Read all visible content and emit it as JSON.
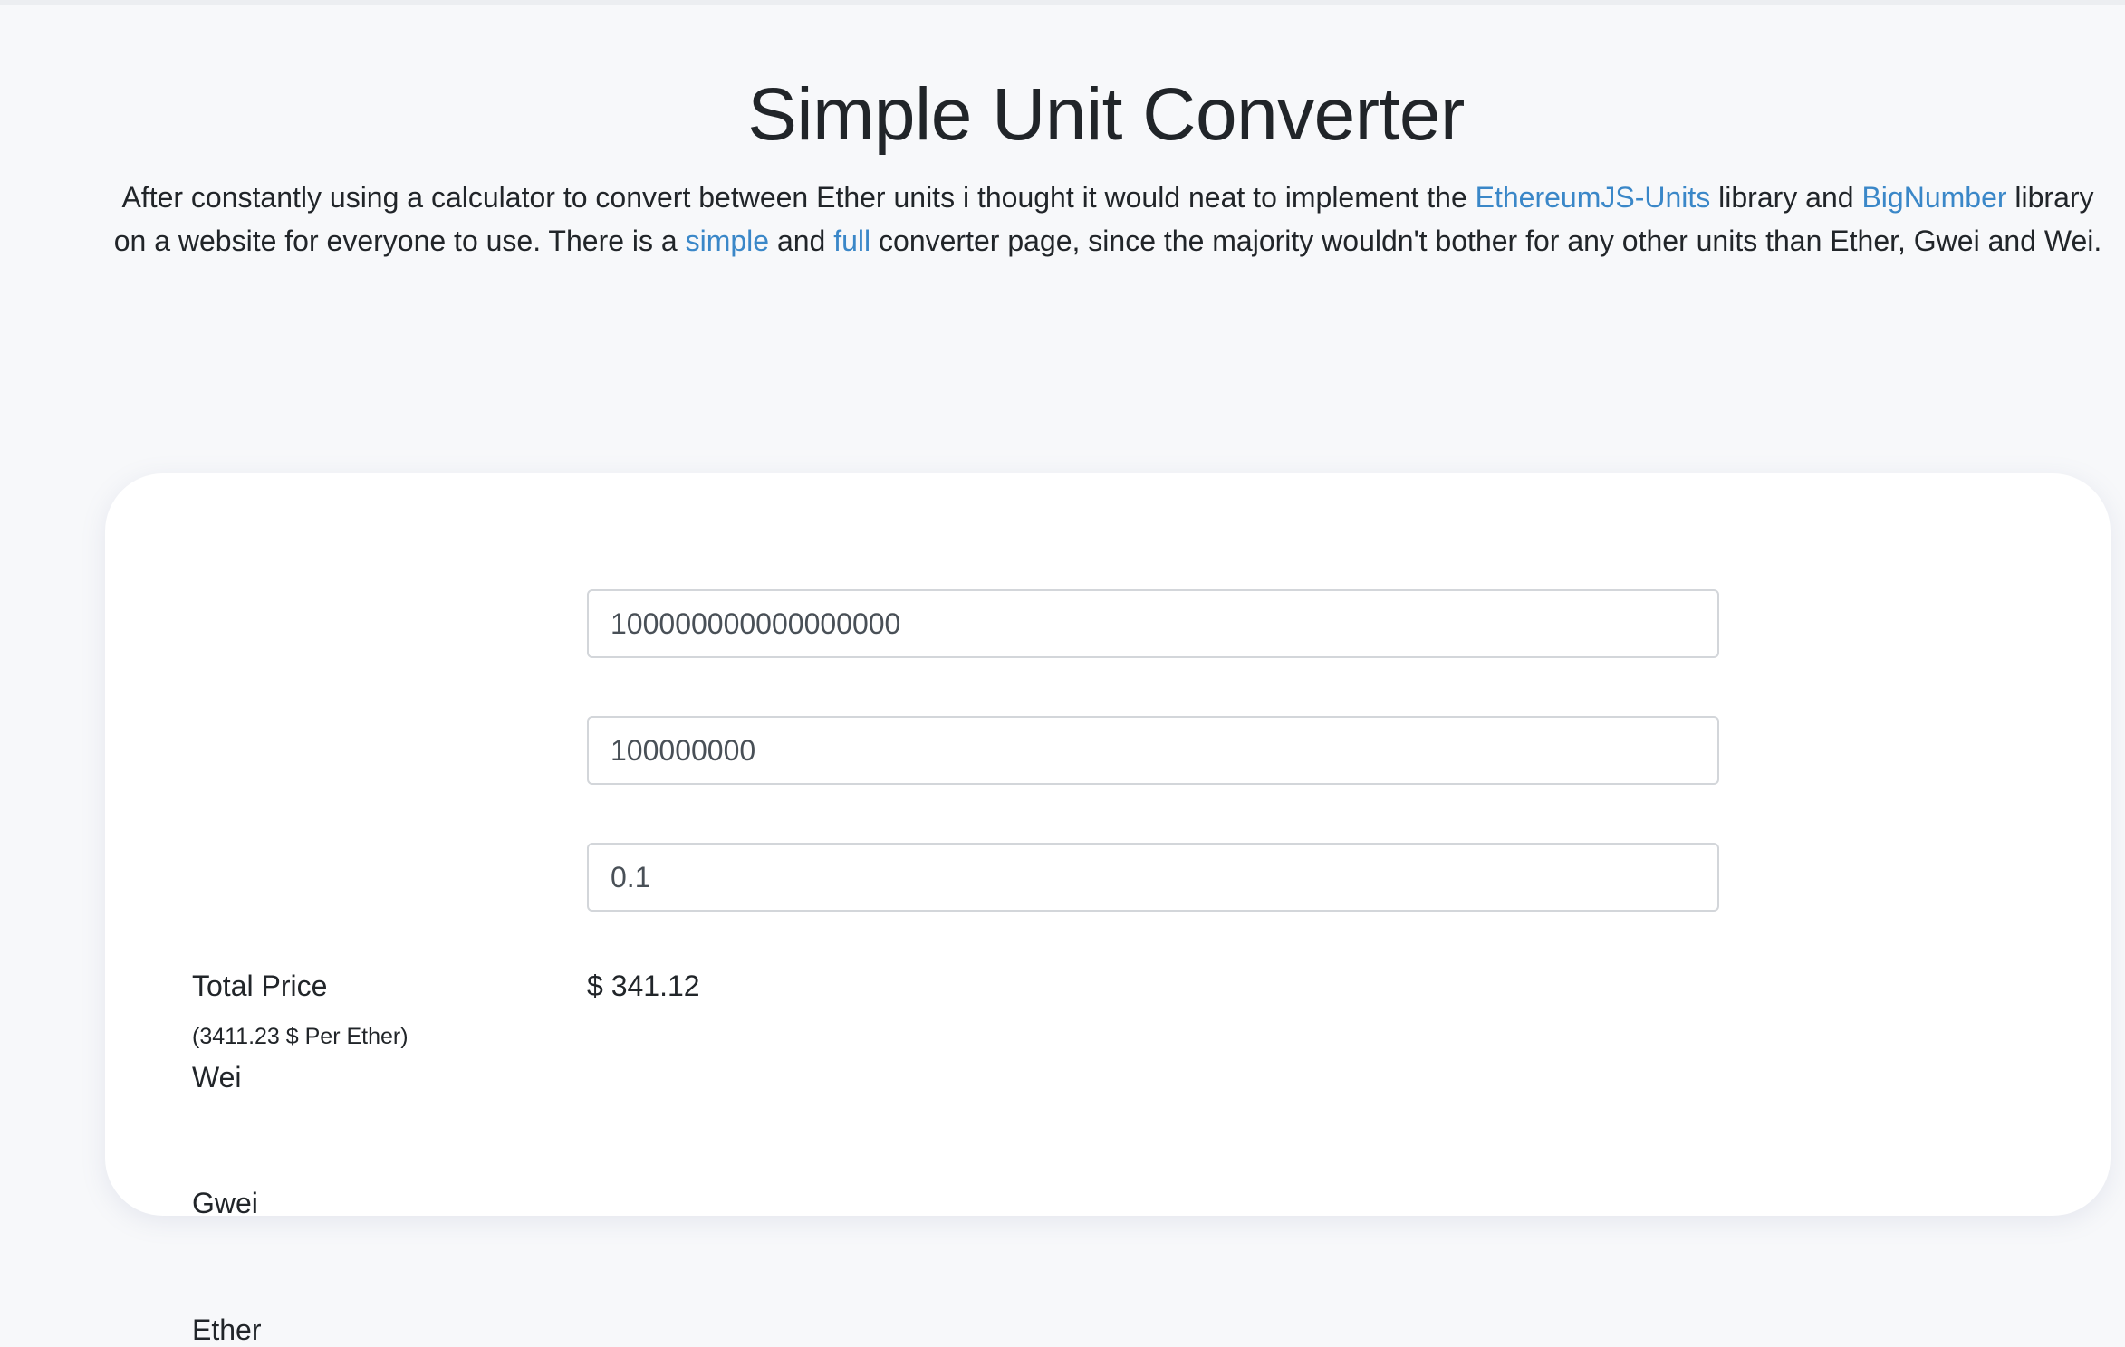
{
  "header": {
    "title": "Simple Unit Converter",
    "intro": {
      "part1": "After constantly using a calculator to convert between Ether units i thought it would neat to implement the ",
      "link_units": "EthereumJS-Units",
      "part2": " library and ",
      "link_bignumber": "BigNumber",
      "part3": " library on a website for everyone to use. There is a ",
      "link_simple": "simple",
      "part4": " and ",
      "link_full": "full",
      "part5": " converter page, since the majority wouldn't bother for any other units than Ether, Gwei and Wei."
    },
    "link_color": "#3a87c8"
  },
  "converter": {
    "wei": {
      "label": "Wei",
      "value": "100000000000000000"
    },
    "gwei": {
      "label": "Gwei",
      "value": "100000000"
    },
    "ether": {
      "label": "Ether",
      "value": "0.1"
    },
    "total": {
      "label": "Total Price",
      "value": "$ 341.12",
      "rate": "(3411.23 $ Per Ether)"
    }
  }
}
